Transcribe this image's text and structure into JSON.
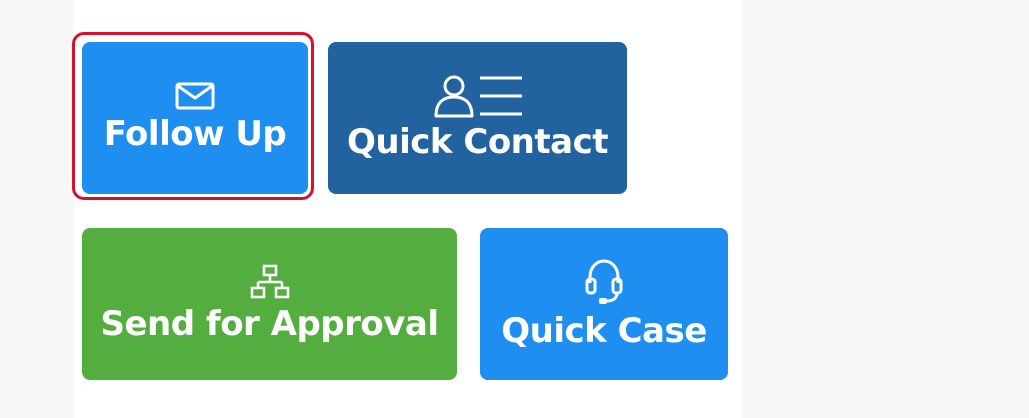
{
  "buttons": {
    "follow_up": {
      "label": "Follow Up",
      "icon": "envelope-icon",
      "color": "#1e8ff0"
    },
    "quick_contact": {
      "label": "Quick Contact",
      "icon": "contact-list-icon",
      "color": "#22639f"
    },
    "send_for_approval": {
      "label": "Send for Approval",
      "icon": "hierarchy-icon",
      "color": "#54ae3f"
    },
    "quick_case": {
      "label": "Quick Case",
      "icon": "headset-icon",
      "color": "#1e8ff0"
    }
  },
  "theme": {
    "selection_color": "#d6102e"
  }
}
